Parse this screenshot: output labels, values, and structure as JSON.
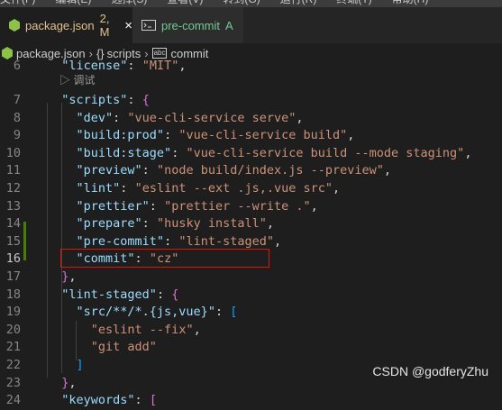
{
  "menubar": {
    "items": [
      "文件(F)",
      "编辑(E)",
      "选择(S)",
      "查看(V)",
      "转到(G)",
      "运行(R)",
      "终端(T)",
      "帮助(H)"
    ]
  },
  "tabs": [
    {
      "label": "package.json",
      "status": "2, M",
      "close": "×",
      "icon": "json-file-icon"
    },
    {
      "label": "pre-commit",
      "status": "A",
      "icon": "terminal-file-icon"
    }
  ],
  "breadcrumb": {
    "file": "package.json",
    "braces": "{}",
    "section": "scripts",
    "leaf_icon": "abc",
    "leaf": "commit"
  },
  "codelens": "▷ 调试",
  "lines": [
    {
      "n": "6",
      "tokens": [
        [
          "p",
          "  "
        ],
        [
          "k",
          "\"license\""
        ],
        [
          "p",
          ": "
        ],
        [
          "s",
          "\"MIT\""
        ],
        [
          "p",
          ","
        ]
      ]
    },
    {
      "n": "7",
      "tokens": [
        [
          "p",
          "  "
        ],
        [
          "k",
          "\"scripts\""
        ],
        [
          "p",
          ": "
        ],
        [
          "b2",
          "{"
        ]
      ]
    },
    {
      "n": "8",
      "tokens": [
        [
          "p",
          "    "
        ],
        [
          "k",
          "\"dev\""
        ],
        [
          "p",
          ": "
        ],
        [
          "s",
          "\"vue-cli-service serve\""
        ],
        [
          "p",
          ","
        ]
      ]
    },
    {
      "n": "9",
      "tokens": [
        [
          "p",
          "    "
        ],
        [
          "k",
          "\"build:prod\""
        ],
        [
          "p",
          ": "
        ],
        [
          "s",
          "\"vue-cli-service build\""
        ],
        [
          "p",
          ","
        ]
      ]
    },
    {
      "n": "10",
      "tokens": [
        [
          "p",
          "    "
        ],
        [
          "k",
          "\"build:stage\""
        ],
        [
          "p",
          ": "
        ],
        [
          "s",
          "\"vue-cli-service build --mode staging\""
        ],
        [
          "p",
          ","
        ]
      ]
    },
    {
      "n": "11",
      "tokens": [
        [
          "p",
          "    "
        ],
        [
          "k",
          "\"preview\""
        ],
        [
          "p",
          ": "
        ],
        [
          "s",
          "\"node build/index.js --preview\""
        ],
        [
          "p",
          ","
        ]
      ]
    },
    {
      "n": "12",
      "tokens": [
        [
          "p",
          "    "
        ],
        [
          "k",
          "\"lint\""
        ],
        [
          "p",
          ": "
        ],
        [
          "s",
          "\"eslint --ext .js,.vue src\""
        ],
        [
          "p",
          ","
        ]
      ]
    },
    {
      "n": "13",
      "tokens": [
        [
          "p",
          "    "
        ],
        [
          "k",
          "\"prettier\""
        ],
        [
          "p",
          ": "
        ],
        [
          "s",
          "\"prettier --write .\""
        ],
        [
          "p",
          ","
        ]
      ]
    },
    {
      "n": "14",
      "tokens": [
        [
          "p",
          "    "
        ],
        [
          "k",
          "\"prepare\""
        ],
        [
          "p",
          ": "
        ],
        [
          "s",
          "\"husky install\""
        ],
        [
          "p",
          ","
        ]
      ]
    },
    {
      "n": "15",
      "tokens": [
        [
          "p",
          "    "
        ],
        [
          "k",
          "\"pre-commit\""
        ],
        [
          "p",
          ": "
        ],
        [
          "s",
          "\"lint-staged\""
        ],
        [
          "p",
          ","
        ]
      ]
    },
    {
      "n": "16",
      "tokens": [
        [
          "p",
          "    "
        ],
        [
          "k",
          "\"commit\""
        ],
        [
          "p",
          ": "
        ],
        [
          "s",
          "\"cz\""
        ]
      ]
    },
    {
      "n": "17",
      "tokens": [
        [
          "p",
          "  "
        ],
        [
          "b2",
          "}"
        ],
        [
          "p",
          ","
        ]
      ]
    },
    {
      "n": "18",
      "tokens": [
        [
          "p",
          "  "
        ],
        [
          "k",
          "\"lint-staged\""
        ],
        [
          "p",
          ": "
        ],
        [
          "b2",
          "{"
        ]
      ]
    },
    {
      "n": "19",
      "tokens": [
        [
          "p",
          "    "
        ],
        [
          "k",
          "\"src/**/*.{js,vue}\""
        ],
        [
          "p",
          ": "
        ],
        [
          "b3",
          "["
        ]
      ]
    },
    {
      "n": "20",
      "tokens": [
        [
          "p",
          "      "
        ],
        [
          "s",
          "\"eslint --fix\""
        ],
        [
          "p",
          ","
        ]
      ]
    },
    {
      "n": "21",
      "tokens": [
        [
          "p",
          "      "
        ],
        [
          "s",
          "\"git add\""
        ]
      ]
    },
    {
      "n": "22",
      "tokens": [
        [
          "p",
          "    "
        ],
        [
          "b3",
          "]"
        ]
      ]
    },
    {
      "n": "23",
      "tokens": [
        [
          "p",
          "  "
        ],
        [
          "b2",
          "}"
        ],
        [
          "p",
          ","
        ]
      ]
    },
    {
      "n": "24",
      "tokens": [
        [
          "p",
          "  "
        ],
        [
          "k",
          "\"keywords\""
        ],
        [
          "p",
          ": "
        ],
        [
          "b2",
          "["
        ]
      ]
    }
  ],
  "current_line": "16",
  "watermark": "CSDN @godferyZhu",
  "colors": {
    "highlight_border": "#e51400",
    "modified_tab": "#e2c08d",
    "added_tab": "#73c991",
    "gutter_added": "#487e02",
    "gutter_modified": "#1b81a8"
  }
}
